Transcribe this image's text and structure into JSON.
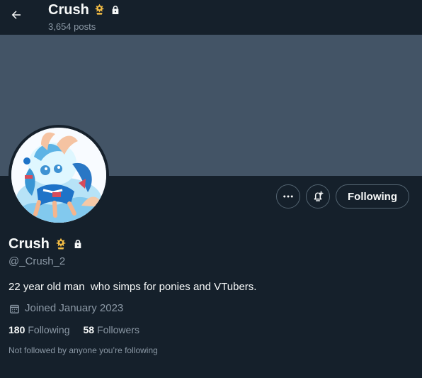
{
  "header": {
    "name": "Crush",
    "posts": "3,654 posts"
  },
  "profile": {
    "display_name": "Crush",
    "handle": "@_Crush_2",
    "bio": "22 year old man  who simps for ponies and VTubers.",
    "joined": "Joined January 2023",
    "following_count": "180",
    "following_label": "Following",
    "followers_count": "58",
    "followers_label": "Followers",
    "not_followed_text": "Not followed by anyone you’re following"
  },
  "actions": {
    "following_button": "Following"
  },
  "icons": {
    "back": "arrow-left-icon",
    "verified": "gold-crown-emblem-icon",
    "protected": "lock-icon",
    "more": "more-dots-icon",
    "notifications": "bell-plus-icon",
    "calendar": "calendar-icon"
  },
  "colors": {
    "background": "#15202b",
    "banner": "#435466",
    "text": "#f7f9f9",
    "muted": "#8b98a5",
    "border": "#536471",
    "badge": "#f4bd45"
  }
}
